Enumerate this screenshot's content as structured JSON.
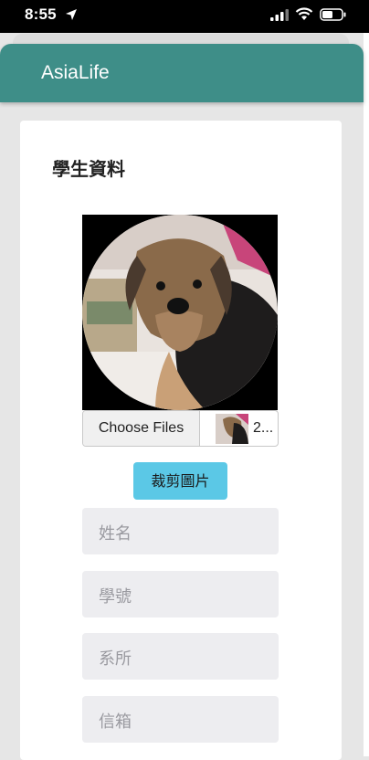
{
  "status_bar": {
    "time": "8:55"
  },
  "app": {
    "title": "AsiaLife"
  },
  "form": {
    "title": "學生資料",
    "file_input": {
      "button_label": "Choose Files",
      "file_name": "2..."
    },
    "crop_button": "裁剪圖片",
    "fields": [
      {
        "placeholder": "姓名"
      },
      {
        "placeholder": "學號"
      },
      {
        "placeholder": "系所"
      },
      {
        "placeholder": "信箱"
      }
    ]
  },
  "colors": {
    "header": "#3e8e88",
    "crop_button": "#5bc8e6",
    "field_bg": "#ededf0"
  }
}
